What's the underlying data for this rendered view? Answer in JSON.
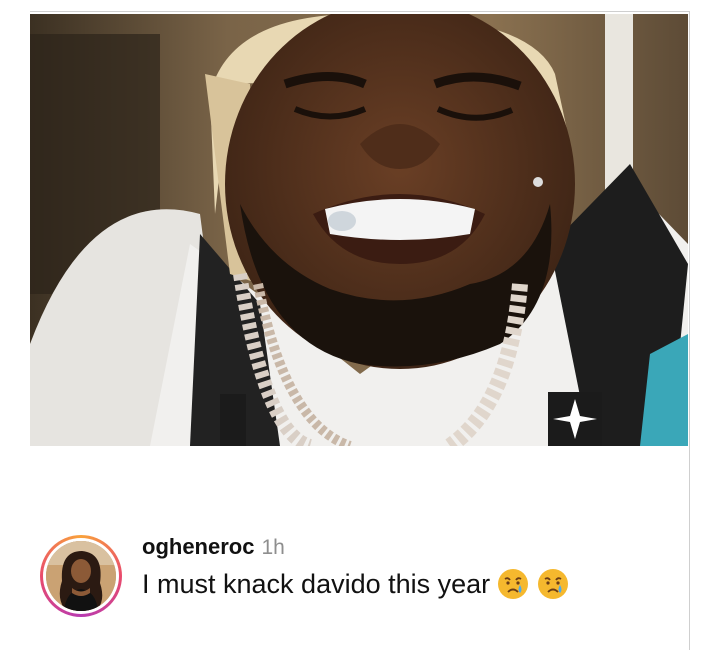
{
  "post": {
    "image_icon": "photo-of-crying-man"
  },
  "comment": {
    "username": "ogheneroc",
    "time": "1h",
    "text": "I must knack davido this year",
    "emojis": [
      "crying-face-icon",
      "crying-face-icon"
    ],
    "avatar_icon": "profile-photo",
    "ring_colors": [
      "#f9a23b",
      "#e94b6c",
      "#b83ab1"
    ]
  }
}
